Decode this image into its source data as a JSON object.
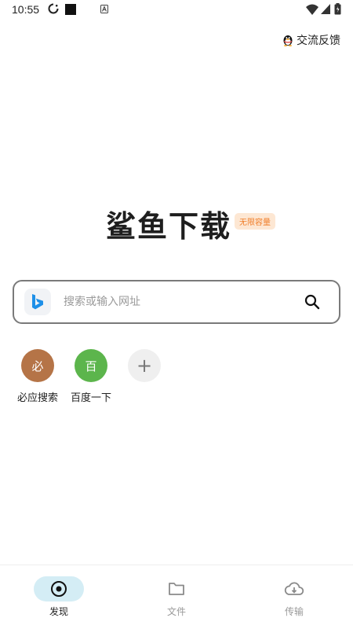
{
  "status_bar": {
    "time": "10:55",
    "icons": [
      "sync-icon",
      "notification-square-icon",
      "a-icon",
      "wifi-icon",
      "signal-icon",
      "battery-icon"
    ]
  },
  "header": {
    "feedback_label": "交流反馈",
    "feedback_icon": "qq-penguin-icon"
  },
  "logo": {
    "title": "鲨鱼下载",
    "badge": "无限容量"
  },
  "search": {
    "placeholder": "搜索或输入网址",
    "value": "",
    "engine_icon": "bing-icon",
    "action_icon": "search-icon"
  },
  "shortcuts": [
    {
      "glyph": "必",
      "label": "必应搜索",
      "color": "#b57447"
    },
    {
      "glyph": "百",
      "label": "百度一下",
      "color": "#5cb54c"
    },
    {
      "glyph": "+",
      "label": "",
      "color": "#efefef"
    }
  ],
  "bottom_nav": [
    {
      "label": "发现",
      "icon": "discover-icon",
      "active": true
    },
    {
      "label": "文件",
      "icon": "folder-icon",
      "active": false
    },
    {
      "label": "传输",
      "icon": "cloud-download-icon",
      "active": false
    }
  ],
  "colors": {
    "accent_badge_bg": "#fde7d3",
    "accent_badge_text": "#f07e2a",
    "nav_active_bg": "#d4edf5",
    "bing_blue": "#1e90e8"
  }
}
